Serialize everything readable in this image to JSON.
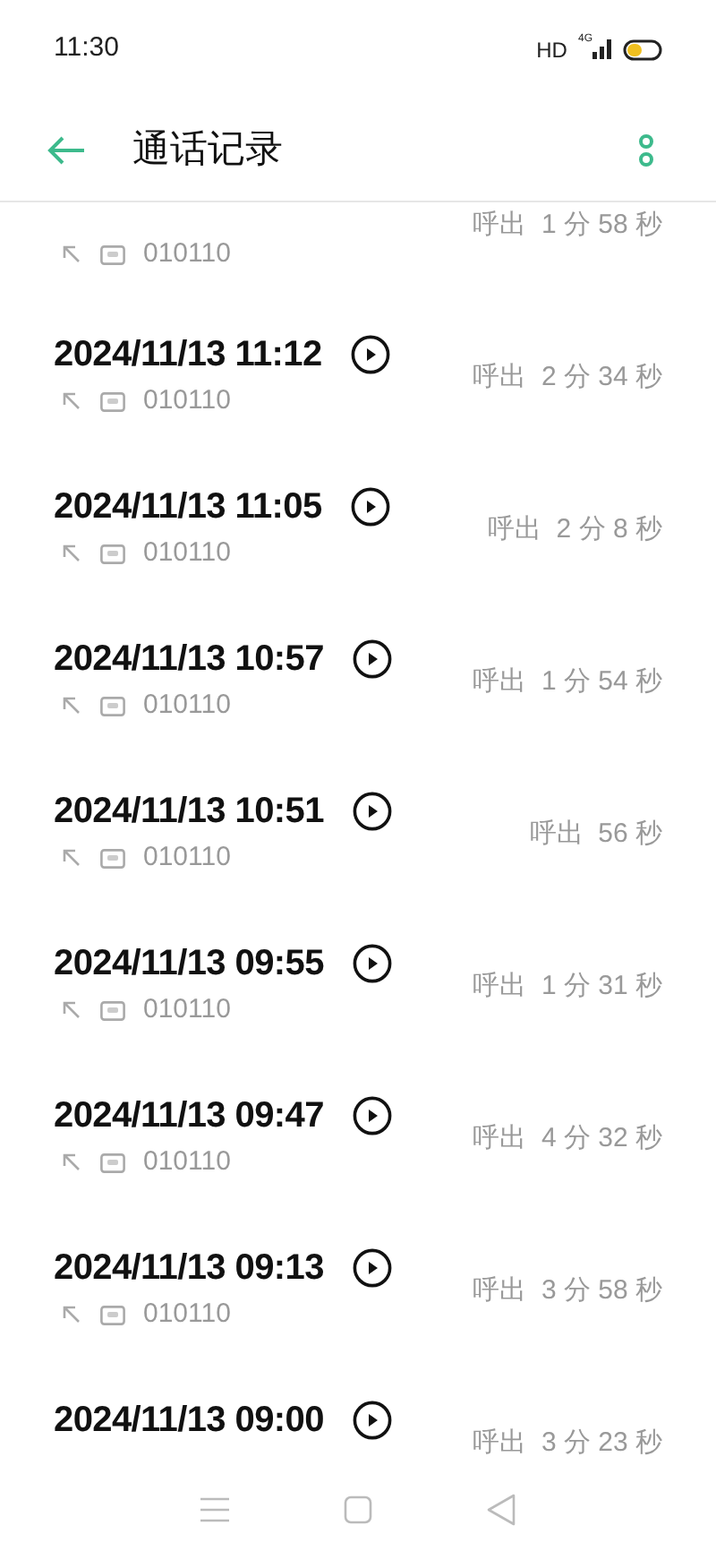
{
  "status_bar": {
    "time": "11:30",
    "hd": "HD",
    "network": "4G"
  },
  "header": {
    "title": "通话记录"
  },
  "calls": [
    {
      "number": "010110",
      "duration": "呼出  1 分 58 秒"
    },
    {
      "time": "2024/11/13 11:12",
      "number": "010110",
      "duration": "呼出  2 分 34 秒"
    },
    {
      "time": "2024/11/13 11:05",
      "number": "010110",
      "duration": "呼出  2 分 8 秒"
    },
    {
      "time": "2024/11/13 10:57",
      "number": "010110",
      "duration": "呼出  1 分 54 秒"
    },
    {
      "time": "2024/11/13 10:51",
      "number": "010110",
      "duration": "呼出  56 秒"
    },
    {
      "time": "2024/11/13 09:55",
      "number": "010110",
      "duration": "呼出  1 分 31 秒"
    },
    {
      "time": "2024/11/13 09:47",
      "number": "010110",
      "duration": "呼出  4 分 32 秒"
    },
    {
      "time": "2024/11/13 09:13",
      "number": "010110",
      "duration": "呼出  3 分 58 秒"
    },
    {
      "time": "2024/11/13 09:00",
      "duration": "呼出  3 分 23 秒"
    }
  ]
}
